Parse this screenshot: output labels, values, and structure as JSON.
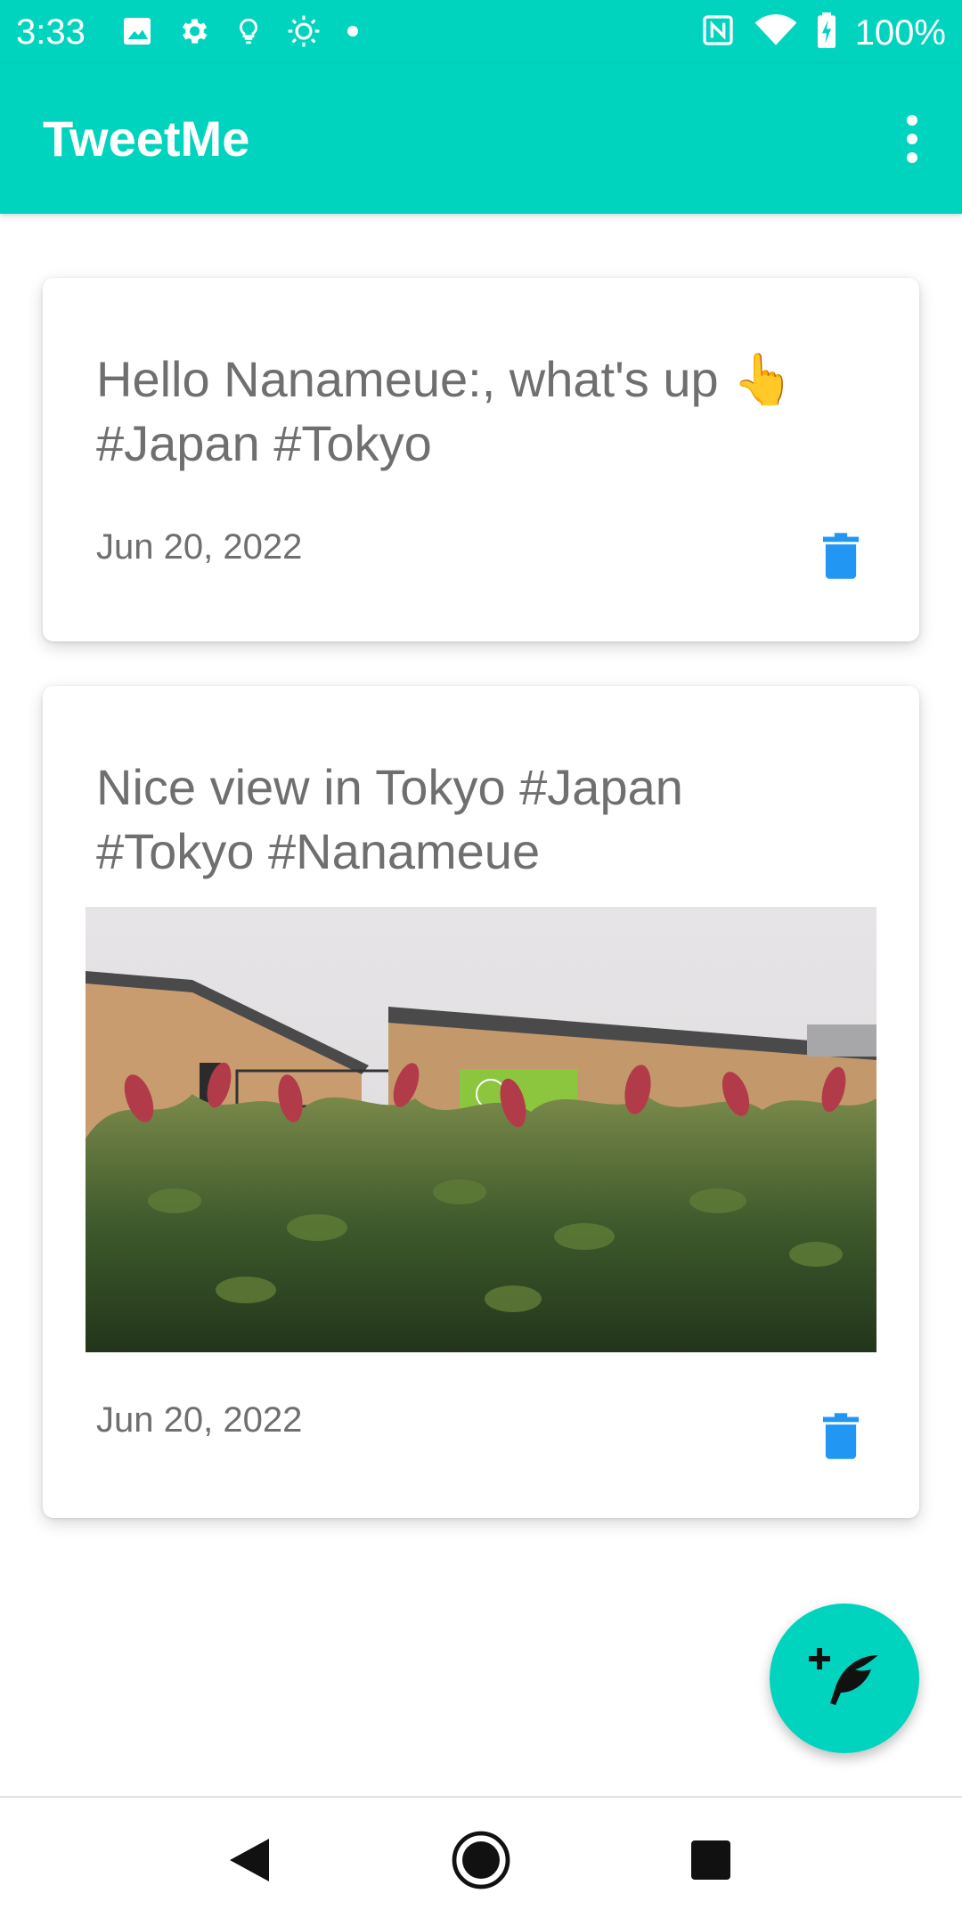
{
  "status_bar": {
    "time": "3:33",
    "battery_percent": "100%",
    "left_icons": [
      "image-icon",
      "gear-icon",
      "lightbulb-icon",
      "brightness-icon",
      "dot-icon"
    ],
    "right_icons": [
      "nfc-icon",
      "wifi-icon",
      "battery-charging-icon"
    ]
  },
  "app_bar": {
    "title": "TweetMe",
    "menu_icon": "more-vert-icon"
  },
  "tweets": [
    {
      "text": "Hello Nanameue:, what's up 👆 #Japan #Tokyo",
      "date": "Jun 20, 2022",
      "has_image": false,
      "delete_icon": "trash-icon"
    },
    {
      "text": "Nice view in Tokyo #Japan #Tokyo #Nanameue",
      "date": "Jun 20, 2022",
      "has_image": true,
      "delete_icon": "trash-icon"
    }
  ],
  "fab": {
    "icon": "add-feather-icon"
  },
  "nav_bar": {
    "buttons": [
      "back-icon",
      "home-icon",
      "recents-icon"
    ]
  },
  "colors": {
    "primary": "#00D4BE",
    "delete_blue": "#2196F3",
    "text_gray": "#6F6F6F"
  }
}
